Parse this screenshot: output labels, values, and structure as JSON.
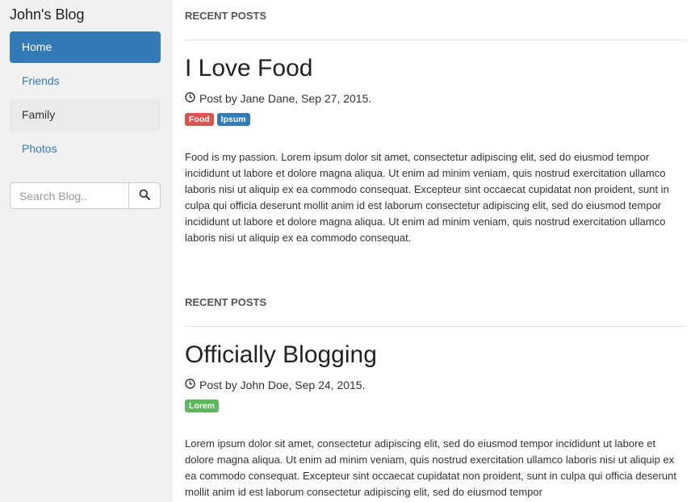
{
  "sidebar": {
    "blog_title": "John's Blog",
    "nav": [
      {
        "label": "Home"
      },
      {
        "label": "Friends"
      },
      {
        "label": "Family"
      },
      {
        "label": "Photos"
      }
    ],
    "search": {
      "placeholder": "Search Blog..",
      "button_icon": "search-icon"
    }
  },
  "posts": [
    {
      "section_label": "RECENT POSTS",
      "title": "I Love Food",
      "meta": "Post by Jane Dane, Sep 27, 2015.",
      "tags": [
        {
          "label": "Food",
          "color": "#d9534f"
        },
        {
          "label": "Ipsum",
          "color": "#337ab7"
        }
      ],
      "body": "Food is my passion. Lorem ipsum dolor sit amet, consectetur adipiscing elit, sed do eiusmod tempor incididunt ut labore et dolore magna aliqua. Ut enim ad minim veniam, quis nostrud exercitation ullamco laboris nisi ut aliquip ex ea commodo consequat. Excepteur sint occaecat cupidatat non proident, sunt in culpa qui officia deserunt mollit anim id est laborum consectetur adipiscing elit, sed do eiusmod tempor incididunt ut labore et dolore magna aliqua. Ut enim ad minim veniam, quis nostrud exercitation ullamco laboris nisi ut aliquip ex ea commodo consequat."
    },
    {
      "section_label": "RECENT POSTS",
      "title": "Officially Blogging",
      "meta": "Post by John Doe, Sep 24, 2015.",
      "tags": [
        {
          "label": "Lorem",
          "color": "#5cb85c"
        }
      ],
      "body": "Lorem ipsum dolor sit amet, consectetur adipiscing elit, sed do eiusmod tempor incididunt ut labore et dolore magna aliqua. Ut enim ad minim veniam, quis nostrud exercitation ullamco laboris nisi ut aliquip ex ea commodo consequat. Excepteur sint occaecat cupidatat non proident, sunt in culpa qui officia deserunt mollit anim id est laborum consectetur adipiscing elit, sed do eiusmod tempor"
    }
  ],
  "colors": {
    "sidebar_bg": "#f1f1f1",
    "accent": "#337ab7"
  }
}
